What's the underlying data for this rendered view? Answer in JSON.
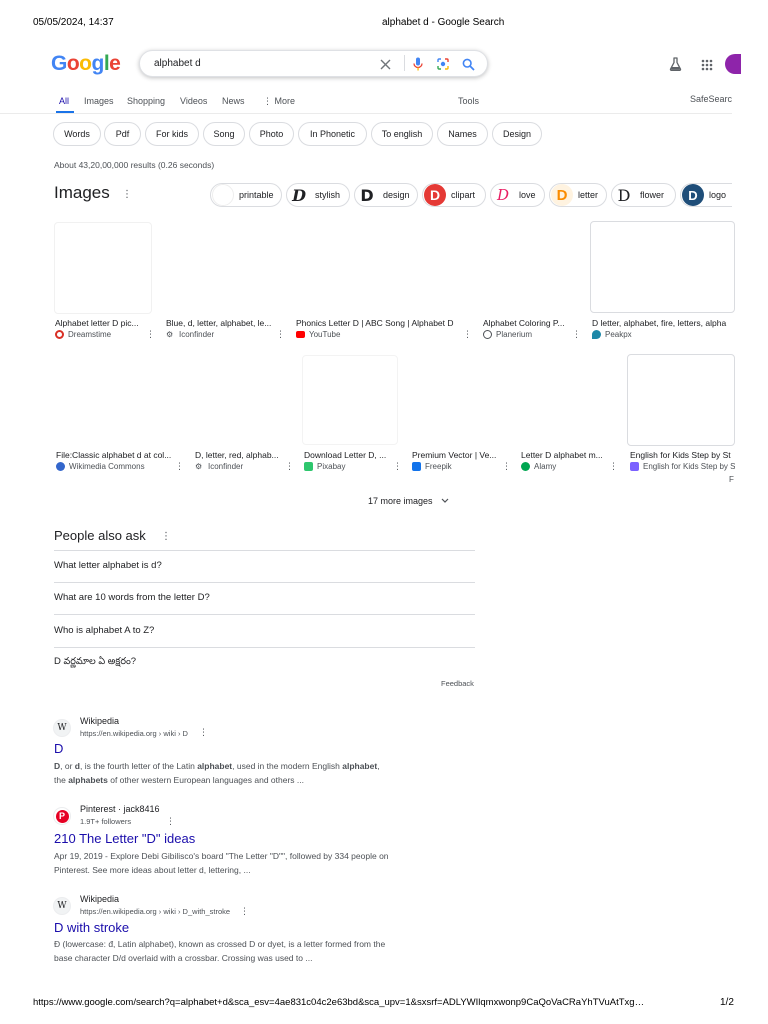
{
  "print_header": {
    "datetime": "05/05/2024, 14:37",
    "title": "alphabet d - Google Search"
  },
  "print_footer": {
    "url": "https://www.google.com/search?q=alphabet+d&sca_esv=4ae831c04c2e63bd&sca_upv=1&sxsrf=ADLYWIlqmxwonp9CaQoVaCRaYhTVuAtTxg…",
    "page": "1/2"
  },
  "logo": {
    "letters": [
      "G",
      "o",
      "o",
      "g",
      "l",
      "e"
    ],
    "colors": [
      "#4285f4",
      "#ea4335",
      "#fbbc05",
      "#4285f4",
      "#34a853",
      "#ea4335"
    ]
  },
  "search": {
    "query": "alphabet d"
  },
  "nav": {
    "tabs": [
      {
        "label": "All",
        "active": true
      },
      {
        "label": "Images"
      },
      {
        "label": "Shopping"
      },
      {
        "label": "Videos"
      },
      {
        "label": "News"
      },
      {
        "label": "⋮ More"
      }
    ],
    "tools": "Tools",
    "safesearch": "SafeSearc"
  },
  "chips": [
    "Words",
    "Pdf",
    "For kids",
    "Song",
    "Photo",
    "In Phonetic",
    "To english",
    "Names",
    "Design"
  ],
  "results_stats": "About 43,20,00,000 results (0.26 seconds)",
  "images": {
    "title": "Images",
    "kebab": "⋮",
    "chips": [
      "printable",
      "stylish",
      "design",
      "clipart",
      "love",
      "letter",
      "flower",
      "logo"
    ],
    "row1": [
      {
        "title": "Alphabet letter D pic...",
        "source": "Dreamstime",
        "color": "#d93025"
      },
      {
        "title": "Blue, d, letter, alphabet, le...",
        "source": "Iconfinder",
        "color": "#202124"
      },
      {
        "title": "Phonics Letter D | ABC Song | Alphabet D",
        "source": "YouTube",
        "color": "#ff0000"
      },
      {
        "title": "Alphabet Coloring P...",
        "source": "Planerium",
        "color": "#4d5156"
      },
      {
        "title": "D letter, alphabet, fire, letters, alpha",
        "source": "Peakpx",
        "color": "#1e88a8"
      }
    ],
    "row2": [
      {
        "title": "File:Classic alphabet d at col...",
        "source": "Wikimedia Commons",
        "color": "#3366cc"
      },
      {
        "title": "D, letter, red, alphab...",
        "source": "Iconfinder",
        "color": "#202124"
      },
      {
        "title": "Download Letter D, ...",
        "source": "Pixabay",
        "color": "#2ec66d"
      },
      {
        "title": "Premium Vector | Ve...",
        "source": "Freepik",
        "color": "#1273eb"
      },
      {
        "title": "Letter D alphabet m...",
        "source": "Alamy",
        "color": "#00a651"
      },
      {
        "title": "English for Kids Step by St",
        "source": "English for Kids Step by S",
        "color": "#7b61ff"
      }
    ],
    "more": "17 more images",
    "stray": "F"
  },
  "paa": {
    "title": "People also ask",
    "questions": [
      "What letter alphabet is d?",
      "What are 10 words from the letter D?",
      "Who is alphabet A to Z?",
      "D వర్ణమాల ఏ అక్షరం?"
    ],
    "feedback": "Feedback"
  },
  "results": [
    {
      "site": "Wikipedia",
      "url": "https://en.wikipedia.org › wiki › D",
      "title": "D",
      "snippet_parts": [
        "D",
        ", or ",
        "d",
        ", is the fourth letter of the Latin ",
        "alphabet",
        ", used in the modern English ",
        "alphabet",
        ",\nthe ",
        "alphabets",
        " of other western European languages and others ..."
      ]
    },
    {
      "site": "Pinterest · jack8416",
      "url": "1.9T+ followers",
      "title": "210 The Letter \"D\" ideas",
      "snippet": "Apr 19, 2019 - Explore Debi Gibilisco's board \"The Letter \"D\"\", followed by 334 people on Pinterest. See more ideas about letter d, lettering, ..."
    },
    {
      "site": "Wikipedia",
      "url": "https://en.wikipedia.org › wiki › D_with_stroke",
      "title": "D with stroke",
      "snippet": "Đ (lowercase: đ, Latin alphabet), known as crossed D or dyet, is a letter formed from the base character D/d overlaid with a crossbar. Crossing was used to ..."
    }
  ]
}
